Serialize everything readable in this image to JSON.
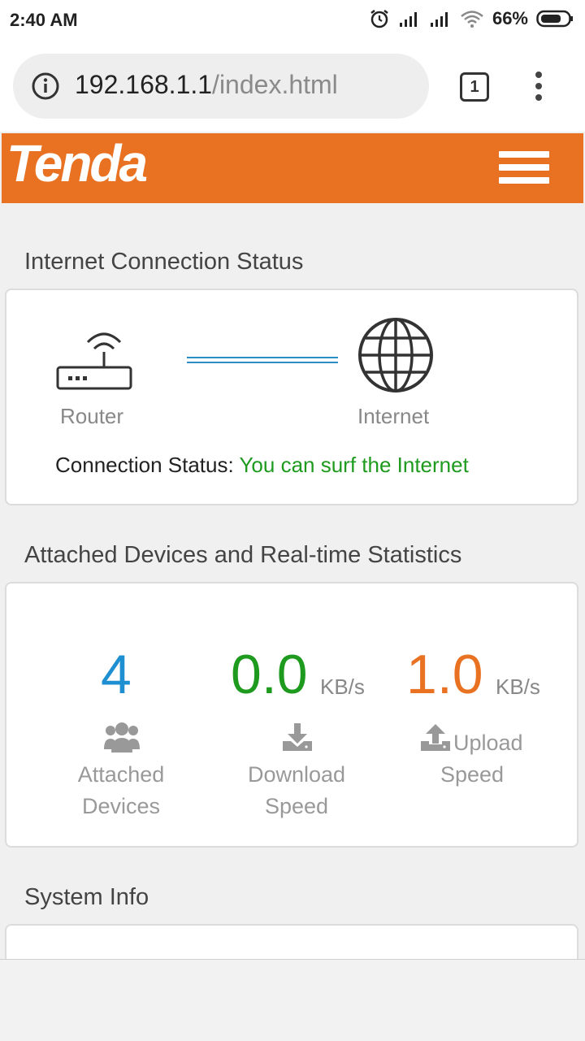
{
  "status_bar": {
    "time": "2:40 AM",
    "battery_percent": "66%",
    "icons": [
      "alarm-icon",
      "signal-icon",
      "signal-icon",
      "wifi-icon",
      "battery-icon"
    ]
  },
  "browser": {
    "url_host": "192.168.1.1",
    "url_path": "/index.html",
    "tab_count": "1"
  },
  "header": {
    "logo_text": "Tenda",
    "brand_color": "#e97222"
  },
  "internet_status": {
    "title": "Internet Connection Status",
    "router_label": "Router",
    "internet_label": "Internet",
    "status_label": "Connection Status:",
    "status_value": "You can surf the Internet",
    "status_color": "#1e9a1e"
  },
  "stats": {
    "title": "Attached Devices and Real-time Statistics",
    "attached_devices": {
      "value": "4",
      "label_line1": "Attached",
      "label_line2": "Devices",
      "color": "#1e8fd0"
    },
    "download": {
      "value": "0.0",
      "unit": "KB/s",
      "label_line1": "Download",
      "label_line2": "Speed",
      "color": "#1e9a1e"
    },
    "upload": {
      "value": "1.0",
      "unit": "KB/s",
      "label_line1": "Upload",
      "label_line2": "Speed",
      "color": "#e97222"
    }
  },
  "system_info": {
    "title": "System Info"
  }
}
